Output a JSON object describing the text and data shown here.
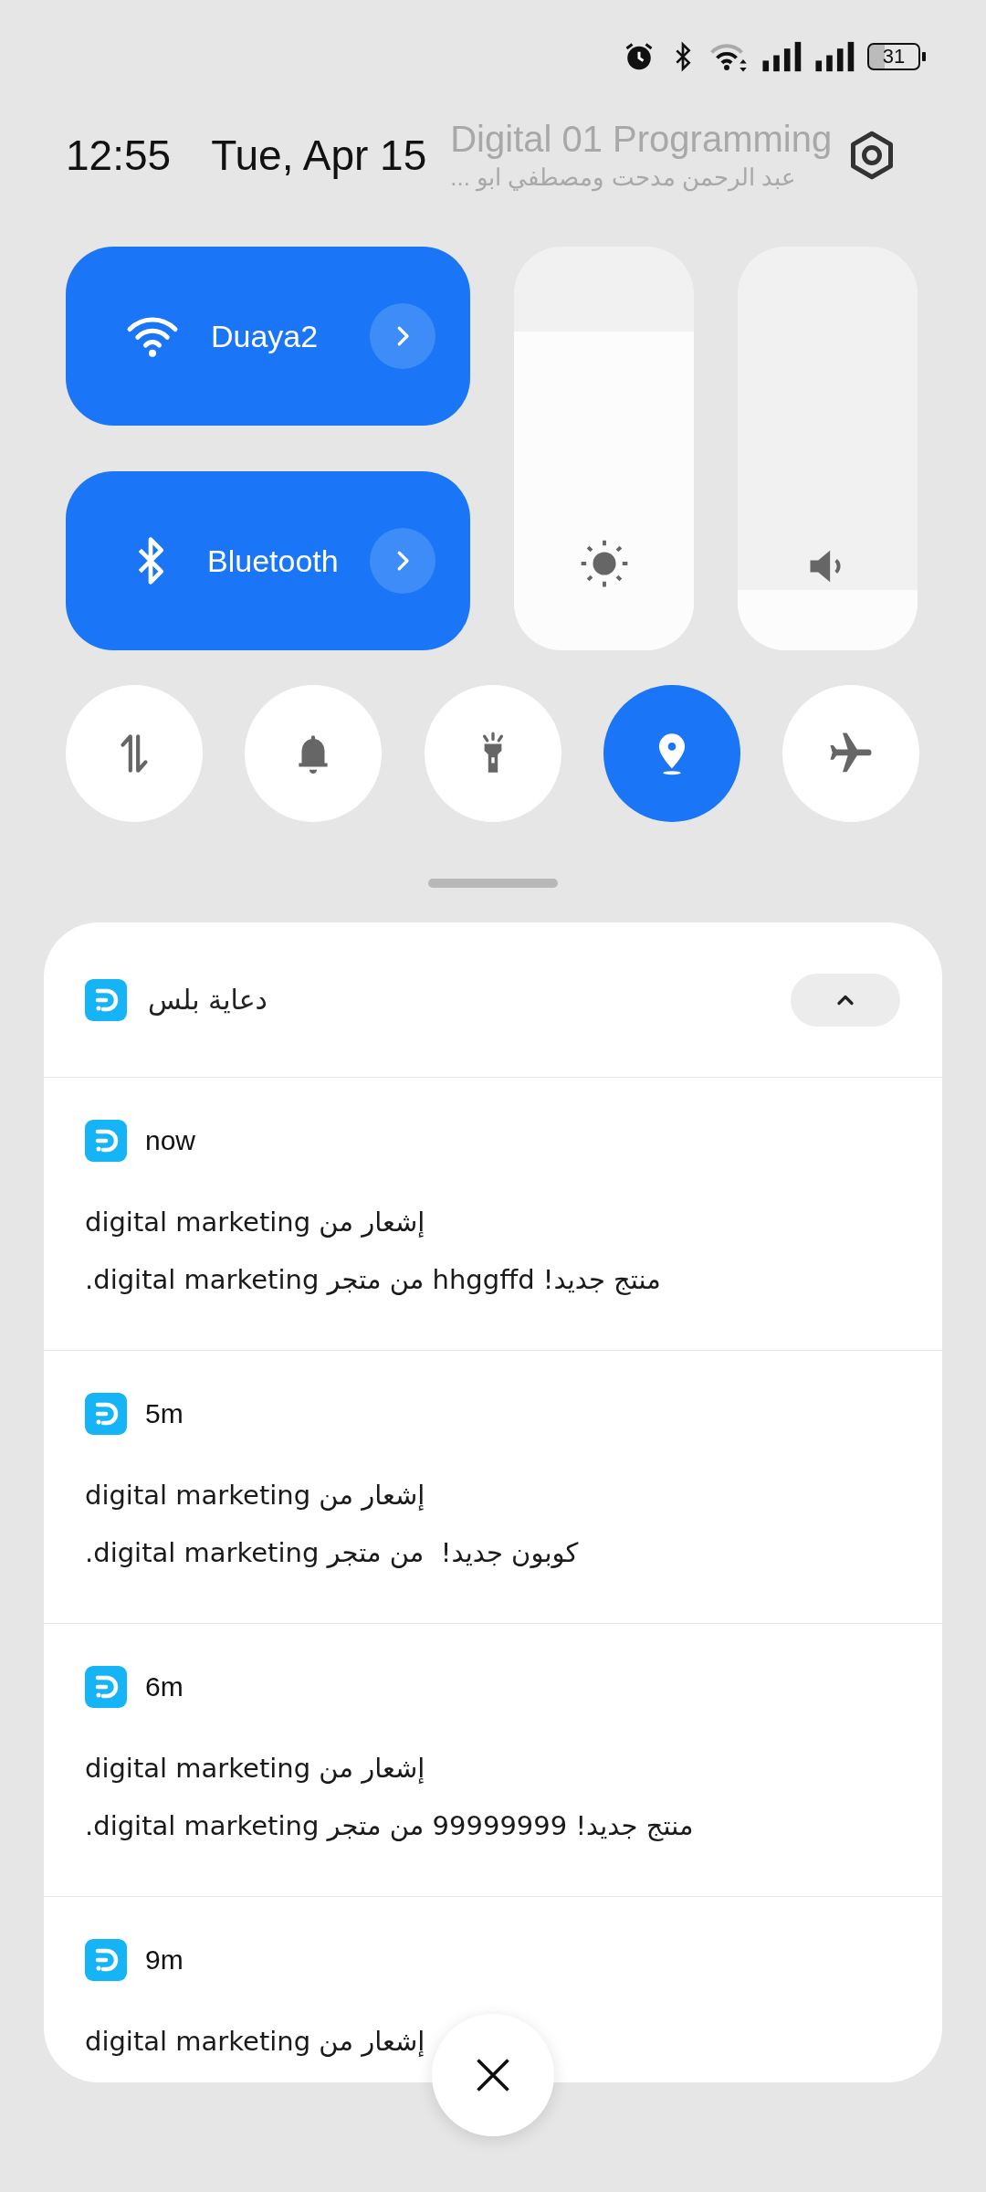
{
  "status_bar": {
    "battery": "31"
  },
  "header": {
    "time": "12:55",
    "date": "Tue, Apr 15",
    "background_title": "Digital 01 Programming",
    "background_subtitle": "عبد الرحمن مدحت ومصطفي ابو ..."
  },
  "tiles": [
    {
      "kind": "wifi",
      "label": "Duaya2",
      "on": true
    },
    {
      "kind": "bluetooth",
      "label": "Bluetooth",
      "on": true
    }
  ],
  "sliders": [
    {
      "kind": "brightness",
      "level": 0.79
    },
    {
      "kind": "volume",
      "level": 0.15
    }
  ],
  "toggles": [
    {
      "kind": "mobile-data",
      "on": false
    },
    {
      "kind": "ringer",
      "on": false
    },
    {
      "kind": "flashlight",
      "on": false
    },
    {
      "kind": "location",
      "on": true
    },
    {
      "kind": "airplane",
      "on": false
    }
  ],
  "notification_group": {
    "app_name": "دعاية بلس",
    "expanded": true,
    "notifications": [
      {
        "time": "now",
        "title": "إشعار من digital marketing",
        "body": "منتج جديد! hhggffd من متجر digital marketing."
      },
      {
        "time": "5m",
        "title": "إشعار من digital marketing",
        "body": "كوبون جديد!  من متجر digital marketing."
      },
      {
        "time": "6m",
        "title": "إشعار من digital marketing",
        "body": "منتج جديد! 99999999 من متجر digital marketing."
      },
      {
        "time": "9m",
        "title": "إشعار من digital marketing"
      }
    ]
  }
}
